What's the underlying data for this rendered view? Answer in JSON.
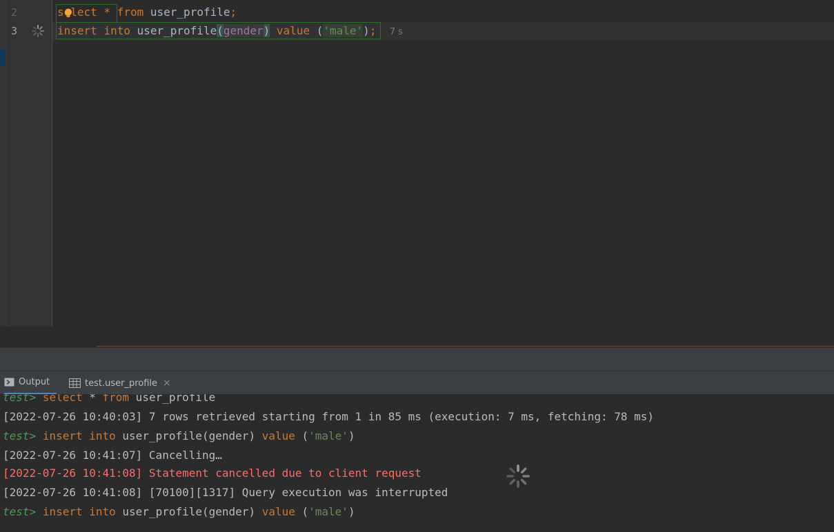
{
  "editor": {
    "lines": [
      {
        "number": "2",
        "tokens": {
          "kw1": "select",
          "star": "*",
          "kw2": "from",
          "table": "user_profile",
          "semi": ";"
        }
      },
      {
        "number": "3",
        "tokens": {
          "kw1": "insert",
          "kw2": "into",
          "table": "user_profile",
          "open": "(",
          "column": "gender",
          "close": ")",
          "kw3": "value",
          "open2": "(",
          "value": "'male'",
          "close2": ")",
          "semi": ";"
        },
        "inlay": "7 s"
      }
    ]
  },
  "tabs": [
    {
      "label": "Output",
      "icon": "terminal-icon",
      "active": true
    },
    {
      "label": "test.user_profile",
      "icon": "table-icon",
      "active": false,
      "close": "×"
    }
  ],
  "output": {
    "lines": [
      {
        "prompt": "test>",
        "kw1": "select",
        "rest1": " * ",
        "kw2": "from",
        "rest2": " user_profile"
      },
      {
        "text": "[2022-07-26 10:40:03] 7 rows retrieved starting from 1 in 85 ms (execution: 7 ms, fetching: 78 ms)"
      },
      {
        "prompt": "test>",
        "kw1": "insert",
        "kw2": "into",
        "mid": " user_profile(gender) ",
        "kw3": "value",
        "str": "'male'"
      },
      {
        "text": "[2022-07-26 10:41:07] Cancelling…"
      },
      {
        "text": "[2022-07-26 10:41:08] Statement cancelled due to client request",
        "kind": "error"
      },
      {
        "text": "[2022-07-26 10:41:08] [70100][1317] Query execution was interrupted"
      },
      {
        "prompt": "test>",
        "kw1": "insert",
        "kw2": "into",
        "mid": " user_profile(gender) ",
        "kw3": "value",
        "str": "'male'"
      }
    ]
  },
  "colors": {
    "keyword": "#cc7832",
    "string": "#6a8759",
    "prompt": "#499c54",
    "error": "#ff6b68",
    "column": "#9876aa"
  }
}
